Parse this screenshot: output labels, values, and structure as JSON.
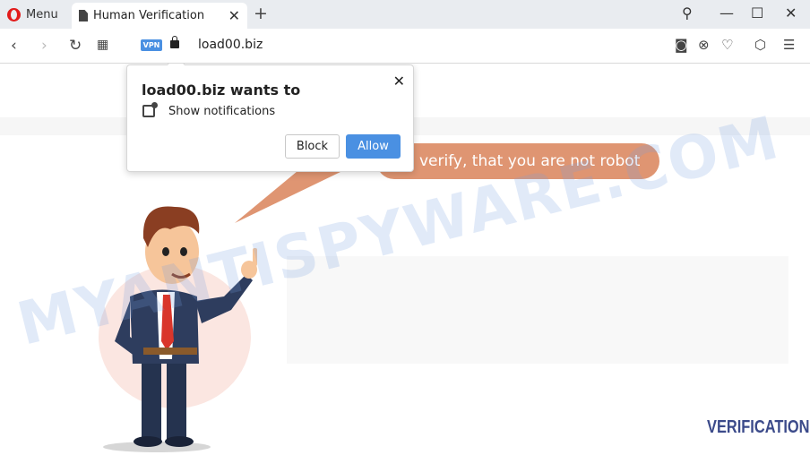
{
  "browser": {
    "menu_label": "Menu",
    "tab_title": "Human Verification",
    "url": "load00.biz",
    "vpn_label": "VPN"
  },
  "page": {
    "speech_text": "verify, that you are not robot",
    "watermark": "MYANTISPYWARE.COM",
    "brand": "VERIFICATION"
  },
  "popup": {
    "title": "load00.biz wants to",
    "permission": "Show notifications",
    "block_label": "Block",
    "allow_label": "Allow"
  },
  "colors": {
    "speech_bubble": "#df9572",
    "allow_button": "#4a90e2",
    "brand": "#3b4a8a"
  }
}
